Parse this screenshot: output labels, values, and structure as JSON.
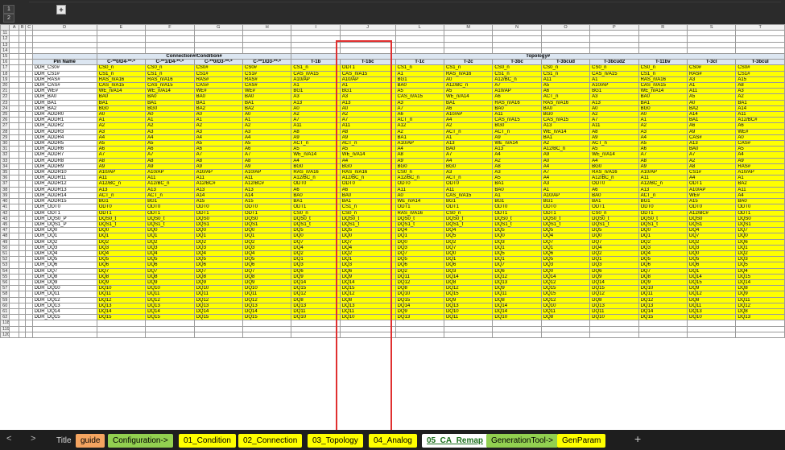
{
  "columns": [
    "A",
    "B",
    "C",
    "D",
    "E",
    "F",
    "G",
    "H",
    "I",
    "J",
    "L",
    "M",
    "N",
    "O",
    "P",
    "R",
    "S",
    "T"
  ],
  "groups": {
    "connection": "Connection#/Condition#",
    "topology": "Topology#"
  },
  "header_row": {
    "row_number": "16",
    "cells": [
      "Pin Name",
      "C-**0/D4-**-*",
      "C-**1/D4-**-*",
      "C-**0/D3-**-*",
      "C-**1/D3-**-*",
      "T-1b",
      "T-1bc",
      "T-1c",
      "T-2c",
      "T-3bc",
      "T-3bcud",
      "T-3bcud2",
      "T-11bv",
      "T-3cl",
      "T-3bcul"
    ]
  },
  "group_row_number": "15",
  "header_rows": [
    "11",
    "12",
    "13",
    "14"
  ],
  "rows": [
    {
      "n": "17",
      "c": [
        "DDR_CS0#",
        "CS0_n",
        "CS0_n",
        "CS0#",
        "CS0#",
        "CS1_n",
        "ODT1",
        "CS1_n",
        "CS1_n",
        "CS0_n",
        "CS0_n",
        "CS0_n",
        "CS0_n",
        "CS0#",
        "CS0#"
      ]
    },
    {
      "n": "18",
      "c": [
        "DDR_CS1#",
        "CS1_n",
        "CS1_n",
        "CS1#",
        "CS1#",
        "CAS_n/A15",
        "CAS_n/A15",
        "A1",
        "RAS_n/A16",
        "CS1_n",
        "CS1_n",
        "CAS_n/A15",
        "CS1_n",
        "RAS#",
        "CS1#"
      ]
    },
    {
      "n": "19",
      "c": [
        "DDR_RAS#",
        "RAS_n/A16",
        "RAS_n/A16",
        "RAS#",
        "RAS#",
        "A10/AP",
        "A10/AP",
        "BG1",
        "A0",
        "A12/BC_n",
        "A11",
        "A1",
        "RAS_n/A16",
        "A3",
        "A15"
      ]
    },
    {
      "n": "20",
      "c": [
        "DDR_CAS#",
        "CAS_n/A15",
        "CAS_n/A15",
        "CAS#",
        "CAS#",
        "A1",
        "A1",
        "BA0",
        "A12/BC_n",
        "A7",
        "A5",
        "A10/AP",
        "CAS_n/A15",
        "A1",
        "A8"
      ]
    },
    {
      "n": "21",
      "c": [
        "DDR_WE#",
        "WE_n/A14",
        "WE_n/A14",
        "WE#",
        "WE#",
        "BG1",
        "BG1",
        "A5",
        "A5",
        "A10/AP",
        "A6",
        "BG1",
        "WE_n/A14",
        "A11",
        "A3"
      ]
    },
    {
      "n": "22",
      "c": [
        "DDR_BA0",
        "BA0",
        "BA0",
        "BA0",
        "BA0",
        "A3",
        "A3",
        "CAS_n/A15",
        "WE_n/A14",
        "A6",
        "ACT_n",
        "A3",
        "BA0",
        "A5",
        "A2"
      ]
    },
    {
      "n": "23",
      "c": [
        "DDR_BA1",
        "BA1",
        "BA1",
        "BA1",
        "BA1",
        "A13",
        "A13",
        "A3",
        "BA1",
        "RAS_n/A16",
        "RAS_n/A16",
        "A13",
        "BA1",
        "A0",
        "BA1"
      ]
    },
    {
      "n": "24",
      "c": [
        "DDR_BA2",
        "BG0",
        "BG0",
        "BA2",
        "BA2",
        "A0",
        "A0",
        "A7",
        "A6",
        "BA0",
        "BA0",
        "A0",
        "BG0",
        "BA2",
        "A14"
      ]
    },
    {
      "n": "25",
      "c": [
        "DDR_ADDR0",
        "A0",
        "A0",
        "A0",
        "A0",
        "A2",
        "A2",
        "A6",
        "A10/AP",
        "A11",
        "BG0",
        "A2",
        "A0",
        "A14",
        "A11"
      ]
    },
    {
      "n": "26",
      "c": [
        "DDR_ADDR1",
        "A1",
        "A1",
        "A1",
        "A1",
        "A7",
        "A7",
        "ACT_n",
        "A4",
        "CAS_n/A15",
        "CAS_n/A15",
        "A7",
        "A1",
        "BA1",
        "A12/BC#"
      ]
    },
    {
      "n": "27",
      "c": [
        "DDR_ADDR2",
        "A2",
        "A2",
        "A2",
        "A2",
        "A11",
        "A11",
        "A12",
        "A2",
        "BG0",
        "A13",
        "A11",
        "A2",
        "A6",
        "A6"
      ]
    },
    {
      "n": "28",
      "c": [
        "DDR_ADDR3",
        "A3",
        "A3",
        "A3",
        "A3",
        "A8",
        "A8",
        "A2",
        "ACT_n",
        "ACT_n",
        "WE_n/A14",
        "A8",
        "A3",
        "A9",
        "WE#"
      ]
    },
    {
      "n": "29",
      "c": [
        "DDR_ADDR4",
        "A4",
        "A4",
        "A4",
        "A4",
        "A9",
        "A9",
        "BA1",
        "A1",
        "A9",
        "BA1",
        "A9",
        "A4",
        "CAS#",
        "A0"
      ]
    },
    {
      "n": "30",
      "c": [
        "DDR_ADDR5",
        "A5",
        "A5",
        "A5",
        "A5",
        "ACT_n",
        "ACT_n",
        "A10/AP",
        "A13",
        "WE_n/A14",
        "A2",
        "ACT_n",
        "A5",
        "A13",
        "CAS#"
      ]
    },
    {
      "n": "31",
      "c": [
        "DDR_ADDR6",
        "A6",
        "A6",
        "A6",
        "A6",
        "A5",
        "A5",
        "A4",
        "BA0",
        "A13",
        "A12/BC_n",
        "A5",
        "A6",
        "BA0",
        "A5"
      ]
    },
    {
      "n": "32",
      "c": [
        "DDR_ADDR7",
        "A7",
        "A7",
        "A7",
        "A7",
        "WE_n/A14",
        "WE_n/A14",
        "A8",
        "A7",
        "A4",
        "A9",
        "WE_n/A14",
        "A7",
        "A7",
        "A4"
      ]
    },
    {
      "n": "33",
      "c": [
        "DDR_ADDR8",
        "A8",
        "A8",
        "A8",
        "A8",
        "A4",
        "A4",
        "A9",
        "A4",
        "A2",
        "A0",
        "A4",
        "A8",
        "A2",
        "A9"
      ]
    },
    {
      "n": "34",
      "c": [
        "DDR_ADDR9",
        "A9",
        "A9",
        "A9",
        "A9",
        "BG0",
        "BG0",
        "BG0",
        "BG0",
        "A8",
        "A4",
        "BG0",
        "A9",
        "A8",
        "RAS#"
      ]
    },
    {
      "n": "35",
      "c": [
        "DDR_ADDR10",
        "A10/AP",
        "A10/AP",
        "A10/AP",
        "A10/AP",
        "RAS_n/A16",
        "RAS_n/A16",
        "CS0_n",
        "A3",
        "A3",
        "A7",
        "RAS_n/A16",
        "A10/AP",
        "CS1#",
        "A10/AP"
      ]
    },
    {
      "n": "36",
      "c": [
        "DDR_ADDR11",
        "A11",
        "A11",
        "A11",
        "A11",
        "A12/BC_n",
        "A12/BC_n",
        "A12/BC_n",
        "ACT_n",
        "A5",
        "A4",
        "A12/BC_n",
        "A11",
        "A4",
        "A1"
      ]
    },
    {
      "n": "37",
      "c": [
        "DDR_ADDR12",
        "A12/BC_n",
        "A12/BC_n",
        "A12/BC#",
        "A12/BC#",
        "ODT0",
        "ODT0",
        "ODT0",
        "ODT0",
        "BA1",
        "A3",
        "ODT0",
        "A12/BC_n",
        "ODT1",
        "BA2"
      ]
    },
    {
      "n": "38",
      "c": [
        "DDR_ADDR13",
        "A13",
        "A13",
        "A13",
        "A13",
        "A6",
        "A6",
        "A11",
        "A11",
        "BA0",
        "A1",
        "A6",
        "A13",
        "A10/AP",
        "A11"
      ]
    },
    {
      "n": "39",
      "c": [
        "DDR_ADDR14",
        "ACT_n",
        "ACT_n",
        "A14",
        "A14",
        "BA0",
        "BA0",
        "A0",
        "CAS_n/A15",
        "A1",
        "A10/AP",
        "BA0",
        "ACT_n",
        "WE#",
        "A4"
      ]
    },
    {
      "n": "40",
      "c": [
        "DDR_ADDR15",
        "BG1",
        "BG1",
        "A15",
        "A15",
        "BA1",
        "BA1",
        "WE_n/A14",
        "BG1",
        "BG1",
        "BG1",
        "BA1",
        "BG1",
        "A15",
        "BA0"
      ]
    },
    {
      "n": "41",
      "c": [
        "DDR_ODT0",
        "ODT0",
        "ODT0",
        "ODT0",
        "ODT0",
        "ODT1",
        "CS1_n",
        "ODT1",
        "ODT1",
        "ODT0",
        "ODT0",
        "ODT1",
        "ODT0",
        "ODT0",
        "ODT0"
      ]
    },
    {
      "n": "42",
      "c": [
        "DDR_ODT1",
        "ODT1",
        "ODT1",
        "ODT1",
        "ODT1",
        "CS0_n",
        "CS0_n",
        "RAS_n/A16",
        "CS0_n",
        "ODT1",
        "ODT1",
        "CS0_n",
        "ODT1",
        "A12/BC#",
        "ODT1"
      ]
    },
    {
      "n": "43",
      "c": [
        "DDR_DQS0_P",
        "DQS0_t",
        "DQS0_t",
        "DQS0",
        "DQS0",
        "DQS0_t",
        "DQS0_t",
        "DQS0_t",
        "DQS0_t",
        "DQS0_t",
        "DQS0_t",
        "DQS0_t",
        "DQS0_t",
        "DQS0",
        "DQS0"
      ]
    },
    {
      "n": "45",
      "c": [
        "DDR_DQS1_P",
        "DQS1_t",
        "DQS1_t",
        "DQS1",
        "DQS1",
        "DQS1_t",
        "DQS1_t",
        "DQS1_t",
        "DQS1_t",
        "DQS1_t",
        "DQS1_t",
        "DQS1_t",
        "DQS1_t",
        "DQS1",
        "DQS1"
      ]
    },
    {
      "n": "47",
      "c": [
        "DDR_DQ0",
        "DQ0",
        "DQ0",
        "DQ0",
        "DQ0",
        "DQ5",
        "DQ5",
        "DQ4",
        "DQ4",
        "DQ5",
        "DQ5",
        "DQ5",
        "DQ0",
        "DQ4",
        "DQ7"
      ]
    },
    {
      "n": "48",
      "c": [
        "DDR_DQ1",
        "DQ1",
        "DQ1",
        "DQ1",
        "DQ1",
        "DQ0",
        "DQ0",
        "DQ1",
        "DQ5",
        "DQ0",
        "DQ4",
        "DQ0",
        "DQ1",
        "DQ7",
        "DQ0"
      ]
    },
    {
      "n": "49",
      "c": [
        "DDR_DQ2",
        "DQ2",
        "DQ2",
        "DQ2",
        "DQ2",
        "DQ7",
        "DQ7",
        "DQ0",
        "DQ2",
        "DQ3",
        "DQ7",
        "DQ7",
        "DQ2",
        "DQ2",
        "DQ6"
      ]
    },
    {
      "n": "50",
      "c": [
        "DDR_DQ3",
        "DQ3",
        "DQ3",
        "DQ3",
        "DQ3",
        "DQ4",
        "DQ4",
        "DQ3",
        "DQ7",
        "DQ1",
        "DQ1",
        "DQ4",
        "DQ3",
        "DQ3",
        "DQ1"
      ]
    },
    {
      "n": "51",
      "c": [
        "DDR_DQ4",
        "DQ4",
        "DQ4",
        "DQ4",
        "DQ4",
        "DQ2",
        "DQ2",
        "DQ7",
        "DQ0",
        "DQ5",
        "DQ6",
        "DQ2",
        "DQ4",
        "DQ0",
        "DQ2"
      ]
    },
    {
      "n": "52",
      "c": [
        "DDR_DQ5",
        "DQ5",
        "DQ5",
        "DQ5",
        "DQ5",
        "DQ1",
        "DQ1",
        "DQ5",
        "DQ1",
        "DQ1",
        "DQ5",
        "DQ1",
        "DQ5",
        "DQ5",
        "DQ3"
      ]
    },
    {
      "n": "53",
      "c": [
        "DDR_DQ6",
        "DQ6",
        "DQ6",
        "DQ6",
        "DQ6",
        "DQ3",
        "DQ3",
        "DQ6",
        "DQ6",
        "DQ7",
        "DQ3",
        "DQ3",
        "DQ6",
        "DQ6",
        "DQ5"
      ]
    },
    {
      "n": "54",
      "c": [
        "DDR_DQ7",
        "DQ7",
        "DQ7",
        "DQ7",
        "DQ7",
        "DQ6",
        "DQ6",
        "DQ2",
        "DQ3",
        "DQ6",
        "DQ0",
        "DQ6",
        "DQ7",
        "DQ1",
        "DQ4"
      ]
    },
    {
      "n": "55",
      "c": [
        "DDR_DQ8",
        "DQ8",
        "DQ8",
        "DQ8",
        "DQ8",
        "DQ9",
        "DQ9",
        "DQ11",
        "DQ14",
        "DQ12",
        "DQ14",
        "DQ9",
        "DQ8",
        "DQ14",
        "DQ15"
      ]
    },
    {
      "n": "56",
      "c": [
        "DDR_DQ9",
        "DQ9",
        "DQ9",
        "DQ9",
        "DQ9",
        "DQ14",
        "DQ14",
        "DQ12",
        "DQ8",
        "DQ13",
        "DQ12",
        "DQ14",
        "DQ9",
        "DQ15",
        "DQ14"
      ]
    },
    {
      "n": "57",
      "c": [
        "DDR_DQ10",
        "DQ10",
        "DQ10",
        "DQ10",
        "DQ10",
        "DQ15",
        "DQ15",
        "DQ8",
        "DQ12",
        "DQ9",
        "DQ15",
        "DQ15",
        "DQ10",
        "DQ9",
        "DQ8"
      ]
    },
    {
      "n": "58",
      "c": [
        "DDR_DQ11",
        "DQ11",
        "DQ11",
        "DQ11",
        "DQ11",
        "DQ12",
        "DQ12",
        "DQ10",
        "DQ15",
        "DQ11",
        "DQ15",
        "DQ12",
        "DQ11",
        "DQ12",
        "DQ9"
      ]
    },
    {
      "n": "59",
      "c": [
        "DDR_DQ12",
        "DQ12",
        "DQ12",
        "DQ12",
        "DQ12",
        "DQ8",
        "DQ8",
        "DQ15",
        "DQ9",
        "DQ8",
        "DQ12",
        "DQ8",
        "DQ12",
        "DQ8",
        "DQ11"
      ]
    },
    {
      "n": "60",
      "c": [
        "DDR_DQ13",
        "DQ13",
        "DQ13",
        "DQ13",
        "DQ13",
        "DQ13",
        "DQ13",
        "DQ14",
        "DQ13",
        "DQ14",
        "DQ10",
        "DQ13",
        "DQ13",
        "DQ11",
        "DQ12"
      ]
    },
    {
      "n": "61",
      "c": [
        "DDR_DQ14",
        "DQ14",
        "DQ14",
        "DQ14",
        "DQ14",
        "DQ11",
        "DQ11",
        "DQ9",
        "DQ10",
        "DQ14",
        "DQ11",
        "DQ11",
        "DQ14",
        "DQ13",
        "DQ8"
      ]
    },
    {
      "n": "62",
      "c": [
        "DDR_DQ15",
        "DQ15",
        "DQ15",
        "DQ15",
        "DQ15",
        "DQ10",
        "DQ10",
        "DQ13",
        "DQ11",
        "DQ10",
        "DQ8",
        "DQ10",
        "DQ15",
        "DQ10",
        "DQ13"
      ]
    }
  ],
  "tail_rows": [
    "118",
    "119",
    "120"
  ],
  "sheet_tabs": [
    {
      "label": "Title",
      "color": ""
    },
    {
      "label": "guide",
      "color": "#f4a460"
    },
    {
      "label": "Configuration->",
      "color": "#92d050"
    },
    {
      "label": "01_Condition",
      "color": "#ffff00"
    },
    {
      "label": "02_Connection",
      "color": "#ffff00"
    },
    {
      "label": "03_Topology",
      "color": "#ffff00"
    },
    {
      "label": "04_Analog",
      "color": "#ffff00"
    },
    {
      "label": "05_CA_Remap",
      "color": "#ffffff"
    },
    {
      "label": "GenerationTool->",
      "color": "#92d050"
    },
    {
      "label": "GenParam",
      "color": "#ffff00"
    }
  ],
  "outline_levels": [
    "1",
    "2"
  ],
  "expand_symbol": "+",
  "nav": {
    "prev": "<",
    "next": ">",
    "add_sheet": "+"
  },
  "highlight_color": "#e03030"
}
